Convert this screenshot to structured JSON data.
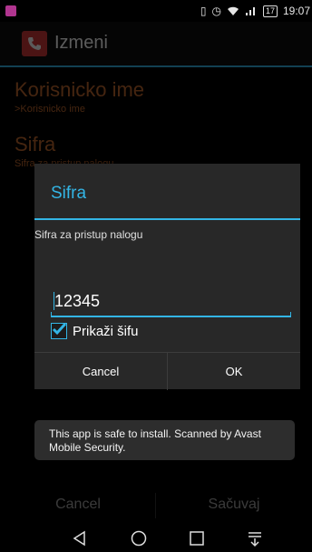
{
  "status_bar": {
    "time": "19:07",
    "battery": "17",
    "app_icon_color": "#b0358f"
  },
  "action_bar": {
    "title": "Izmeni",
    "icon": "phone-icon"
  },
  "preferences": [
    {
      "title": "Korisnicko ime",
      "summary": ">Korisnicko ime"
    },
    {
      "title": "Sifra",
      "summary": "Sifra za pristup nalogu"
    }
  ],
  "dialog": {
    "title": "Sifra",
    "message": "Sifra za pristup nalogu",
    "password_value": "12345",
    "show_password_label": "Prikaži šifu",
    "show_password_checked": true,
    "cancel_label": "Cancel",
    "ok_label": "OK"
  },
  "bottom_buttons": {
    "cancel": "Cancel",
    "save": "Sačuvaj"
  },
  "toast": {
    "message": "This app is safe to install. Scanned by Avast Mobile Security."
  },
  "colors": {
    "accent": "#33b5e5",
    "preference_title": "#ff8a3d",
    "app_icon": "#d43b3b"
  },
  "navigation": [
    "back-icon",
    "home-icon",
    "recents-icon",
    "notifications-icon"
  ]
}
